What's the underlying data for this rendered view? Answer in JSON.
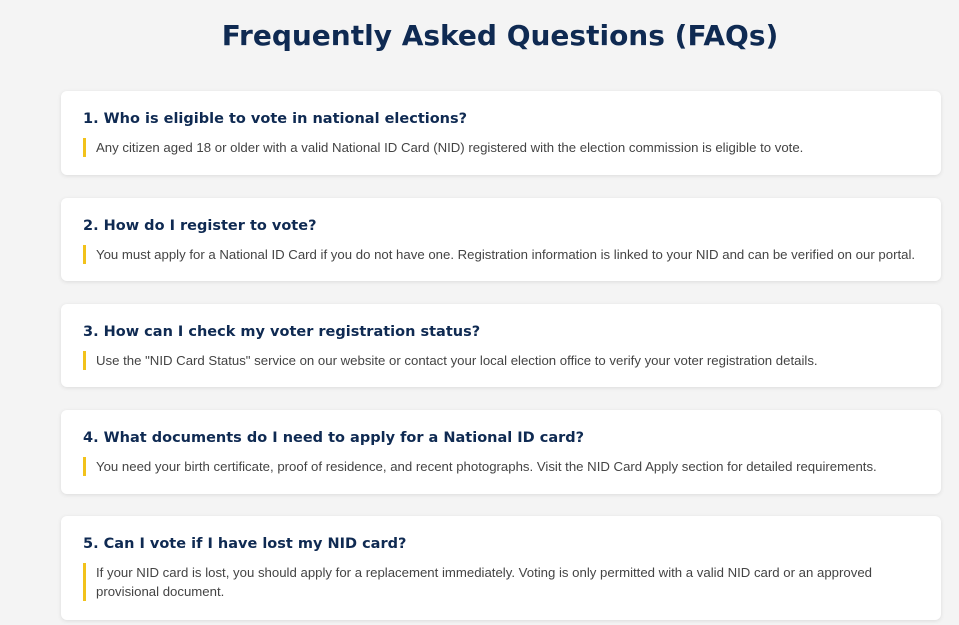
{
  "page": {
    "title": "Frequently Asked Questions (FAQs)"
  },
  "faqs": [
    {
      "question": "1. Who is eligible to vote in national elections?",
      "answer": "Any citizen aged 18 or older with a valid National ID Card (NID) registered with the election commission is eligible to vote."
    },
    {
      "question": "2. How do I register to vote?",
      "answer": "You must apply for a National ID Card if you do not have one. Registration information is linked to your NID and can be verified on our portal."
    },
    {
      "question": "3. How can I check my voter registration status?",
      "answer": "Use the \"NID Card Status\" service on our website or contact your local election office to verify your voter registration details."
    },
    {
      "question": "4. What documents do I need to apply for a National ID card?",
      "answer": "You need your birth certificate, proof of residence, and recent photographs. Visit the NID Card Apply section for detailed requirements."
    },
    {
      "question": "5. Can I vote if I have lost my NID card?",
      "answer": "If your NID card is lost, you should apply for a replacement immediately. Voting is only permitted with a valid NID card or an approved provisional document."
    }
  ],
  "colors": {
    "background": "#f4f4f4",
    "heading": "#0f2a52",
    "accent_bar": "#f2c21b",
    "answer_text": "#444444",
    "card": "#ffffff"
  }
}
